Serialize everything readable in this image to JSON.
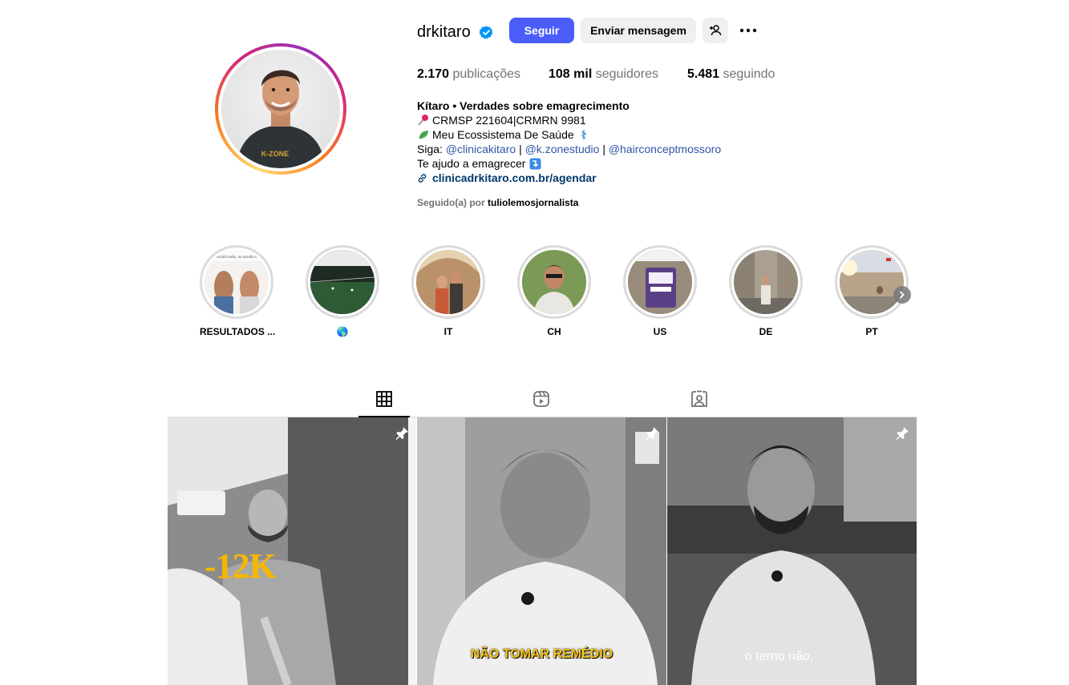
{
  "profile": {
    "username": "drkitaro",
    "follow_label": "Seguir",
    "message_label": "Enviar mensagem",
    "stats": {
      "posts_value": "2.170",
      "posts_label": "publicações",
      "followers_value": "108 mil",
      "followers_label": "seguidores",
      "following_value": "5.481",
      "following_label": "seguindo"
    },
    "bio": {
      "name": "Kítaro • Verdades sobre emagrecimento",
      "line1": "CRMSP 221604|CRMRN 9981",
      "line2": "Meu Ecossistema De Saúde",
      "line3_prefix": "Siga:",
      "mention1": "@clinicakitaro",
      "mention2": "@k.zonestudio",
      "mention3": "@hairconceptmossoro",
      "sep": "|",
      "line4": "Te ajudo a emagrecer",
      "link": "clinicadrkitaro.com.br/agendar"
    },
    "followed_by_prefix": "Seguido(a) por",
    "followed_by_user": "tuliolemosjornalista",
    "avatar_shirt_text": "K-ZONE"
  },
  "highlights": [
    {
      "label": "RESULTADOS ...",
      "inner_text": "Da escolh muito, ou escolh muito"
    },
    {
      "label": "🌎",
      "inner_text": ""
    },
    {
      "label": "IT",
      "inner_text": ""
    },
    {
      "label": "CH",
      "inner_text": ""
    },
    {
      "label": "US",
      "inner_text": ""
    },
    {
      "label": "DE",
      "inner_text": ""
    },
    {
      "label": "PT",
      "inner_text": ""
    }
  ],
  "tabs": [
    "posts-grid-icon",
    "reels-icon",
    "tagged-icon"
  ],
  "posts": [
    {
      "caption": "-12K",
      "pinned": true
    },
    {
      "caption": "NÃO TOMAR REMÉDIO",
      "pinned": true
    },
    {
      "caption": "o terno não,",
      "pinned": true
    }
  ],
  "colors": {
    "accent": "#4a5df9",
    "verified": "#0095f6",
    "link": "#00376b",
    "mention": "#3154a8",
    "muted": "#737373",
    "caption_yellow": "#f5b800"
  }
}
